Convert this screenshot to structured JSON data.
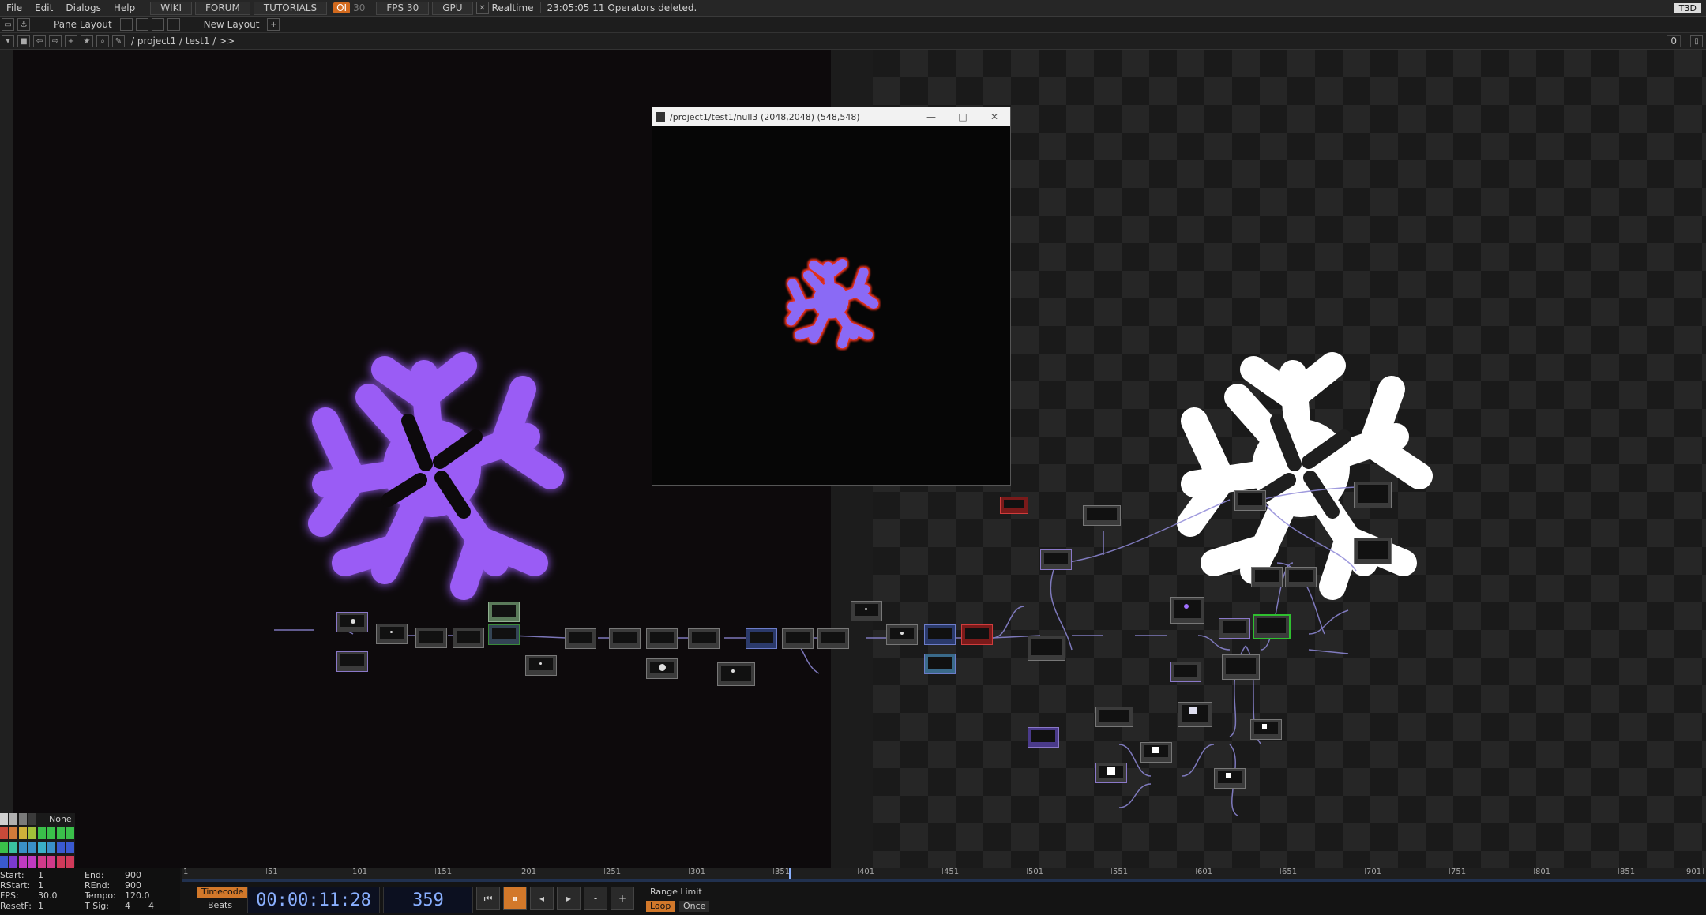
{
  "menu": {
    "items": [
      "File",
      "Edit",
      "Dialogs",
      "Help"
    ],
    "wiki": "WIKI",
    "forum": "FORUM",
    "tutorials": "TUTORIALS",
    "oi": "OI",
    "oi_count": "30",
    "fps": "FPS  30",
    "gpu": "GPU",
    "realtime": "Realtime",
    "status": "23:05:05 11 Operators deleted.",
    "t3d": "T3D"
  },
  "panebar": {
    "pane_layout": "Pane Layout",
    "new_layout": "New Layout",
    "add": "+"
  },
  "pathbar": {
    "path": "/ project1 / test1 / >>",
    "count": "0"
  },
  "viewer": {
    "title": "/project1/test1/null3 (2048,2048) (548,548)",
    "controls": [
      "—",
      "□",
      "✕"
    ]
  },
  "palette": {
    "none_label": "None",
    "colors": [
      "#d0d0d0",
      "#b0b0b0",
      "#7a7a7a",
      "#3a3a3a",
      "#c84a3a",
      "#d07a3a",
      "#d0b03a",
      "#a0c03a",
      "#3ac04a",
      "#3ac0a0",
      "#3a90c8",
      "#3a5ad0",
      "#7a3ad0",
      "#c03ac0",
      "#d03a8a",
      "#d03a5a"
    ]
  },
  "timeinfo": {
    "start_label": "Start:",
    "start": "1",
    "rstart_label": "RStart:",
    "rstart": "1",
    "fps_label": "FPS:",
    "fps": "30.0",
    "resetf_label": "ResetF:",
    "resetf": "1",
    "end_label": "End:",
    "end": "900",
    "rend_label": "REnd:",
    "rend": "900",
    "tempo_label": "Tempo:",
    "tempo": "120.0",
    "tsig_label": "T Sig:",
    "tsig_a": "4",
    "tsig_b": "4"
  },
  "transport": {
    "timecode_label": "Timecode",
    "beats_label": "Beats",
    "timecode": "00:00:11:28",
    "frame": "359",
    "range_limit": "Range Limit",
    "loop": "Loop",
    "once": "Once",
    "buttons": [
      "⏮",
      "⏸",
      "◂",
      "▸",
      "-",
      "+"
    ]
  },
  "ruler": {
    "labels": [
      "1",
      "51",
      "101",
      "151",
      "201",
      "251",
      "301",
      "351",
      "401",
      "451",
      "501",
      "551",
      "601",
      "651",
      "701",
      "751",
      "801",
      "851",
      "901"
    ]
  },
  "colors": {
    "accent_orange": "#d2782a",
    "blob_purple": "#9a5cf5",
    "blob_white": "#ffffff",
    "selected_green": "#2fc02f"
  }
}
